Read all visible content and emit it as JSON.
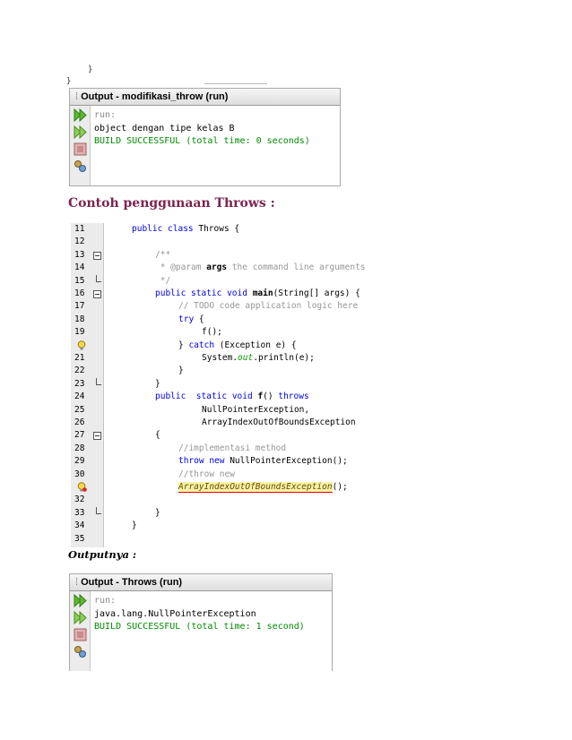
{
  "top_fragment": {
    "brace": "}"
  },
  "panel1": {
    "title": "Output - modifikasi_throw (run)",
    "lines": [
      "run:",
      "object dengan tipe kelas B",
      "BUILD SUCCESSFUL (total time: 0 seconds)"
    ],
    "tools": [
      "rerun-icon",
      "rerun-with-options-icon",
      "stop-icon",
      "settings-icon"
    ]
  },
  "heading": "Contoh penggunaan Throws :",
  "code": {
    "line_numbers": [
      "11",
      "12",
      "13",
      "14",
      "15",
      "16",
      "17",
      "18",
      "19",
      "",
      "21",
      "22",
      "23",
      "24",
      "25",
      "26",
      "27",
      "28",
      "29",
      "30",
      "",
      "32",
      "33",
      "34",
      "35"
    ],
    "lines": [
      "public class Throws {",
      "",
      "/**",
      " * @param args the command line arguments",
      " */",
      "public static void main(String[] args) {",
      "// TODO code application logic here",
      "try {",
      "f();",
      "} catch (Exception e) {",
      "System.out.println(e);",
      "}",
      "}",
      "public  static void f() throws",
      "NullPointerException,",
      "ArrayIndexOutOfBoundsException",
      "{",
      "//implementasi method",
      "throw new NullPointerException();",
      "//throw new",
      "ArrayIndexOutOfBoundsException();",
      "",
      "}",
      "}",
      ""
    ]
  },
  "subheading": "Outputnya :",
  "panel2": {
    "title": "Output - Throws (run)",
    "lines": [
      "run:",
      "java.lang.NullPointerException",
      "BUILD SUCCESSFUL (total time: 1 second)"
    ],
    "tools": [
      "rerun-icon",
      "rerun-with-options-icon",
      "stop-icon",
      "settings-icon"
    ]
  },
  "colors": {
    "heading": "#7d2350",
    "keyword": "#0000e6",
    "comment": "#969696",
    "success": "#008a00"
  }
}
